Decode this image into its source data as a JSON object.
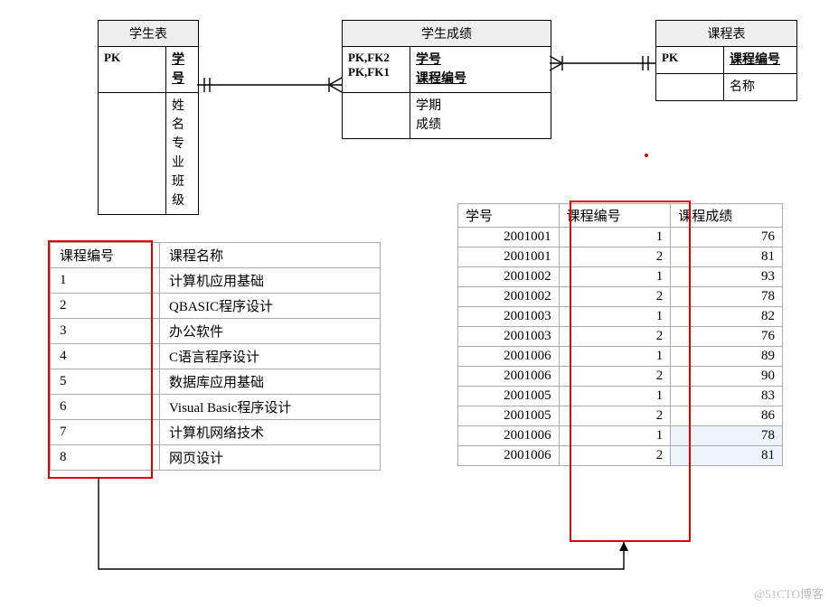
{
  "entities": {
    "student": {
      "title": "学生表",
      "pk_label": "PK",
      "pk_field": "学号",
      "body_fields": "姓名\n专业\n班级"
    },
    "score": {
      "title": "学生成绩",
      "pk_label": "PK,FK2\nPK,FK1",
      "pk_field": "学号\n课程编号",
      "body_fields": "学期\n成绩"
    },
    "course": {
      "title": "课程表",
      "pk_label": "PK",
      "pk_field": "课程编号",
      "body_fields": "名称"
    }
  },
  "course_table": {
    "headers": [
      "课程编号",
      "课程名称"
    ],
    "rows": [
      [
        "1",
        "计算机应用基础"
      ],
      [
        "2",
        "QBASIC程序设计"
      ],
      [
        "3",
        "办公软件"
      ],
      [
        "4",
        "C语言程序设计"
      ],
      [
        "5",
        "数据库应用基础"
      ],
      [
        "6",
        "Visual Basic程序设计"
      ],
      [
        "7",
        "计算机网络技术"
      ],
      [
        "8",
        "网页设计"
      ]
    ]
  },
  "score_table": {
    "headers": [
      "学号",
      "课程编号",
      "课程成绩"
    ],
    "rows": [
      [
        "2001001",
        "1",
        "76"
      ],
      [
        "2001001",
        "2",
        "81"
      ],
      [
        "2001002",
        "1",
        "93"
      ],
      [
        "2001002",
        "2",
        "78"
      ],
      [
        "2001003",
        "1",
        "82"
      ],
      [
        "2001003",
        "2",
        "76"
      ],
      [
        "2001006",
        "1",
        "89"
      ],
      [
        "2001006",
        "2",
        "90"
      ],
      [
        "2001005",
        "1",
        "83"
      ],
      [
        "2001005",
        "2",
        "86"
      ],
      [
        "2001006",
        "1",
        "78"
      ],
      [
        "2001006",
        "2",
        "81"
      ]
    ],
    "faded_rows": [
      10,
      11
    ]
  },
  "watermark": "@51CTO博客",
  "chart_data": {
    "type": "table",
    "description": "Entity-relationship diagram with three entities (学生表, 学生成绩, 课程表) connected by identifying relationships; below, two data tables illustrate foreign-key linkage between 课程编号 columns.",
    "entities": [
      {
        "name": "学生表",
        "pk": [
          "学号"
        ],
        "attrs": [
          "姓名",
          "专业",
          "班级"
        ]
      },
      {
        "name": "学生成绩",
        "pk": [
          "学号",
          "课程编号"
        ],
        "fk": [
          "学号",
          "课程编号"
        ],
        "attrs": [
          "学期",
          "成绩"
        ]
      },
      {
        "name": "课程表",
        "pk": [
          "课程编号"
        ],
        "attrs": [
          "名称"
        ]
      }
    ],
    "relationships": [
      {
        "from": "学生表",
        "to": "学生成绩",
        "cardinality": "1:N"
      },
      {
        "from": "课程表",
        "to": "学生成绩",
        "cardinality": "1:N"
      }
    ],
    "course_data": {
      "columns": [
        "课程编号",
        "课程名称"
      ],
      "rows": [
        [
          1,
          "计算机应用基础"
        ],
        [
          2,
          "QBASIC程序设计"
        ],
        [
          3,
          "办公软件"
        ],
        [
          4,
          "C语言程序设计"
        ],
        [
          5,
          "数据库应用基础"
        ],
        [
          6,
          "Visual Basic程序设计"
        ],
        [
          7,
          "计算机网络技术"
        ],
        [
          8,
          "网页设计"
        ]
      ]
    },
    "score_data": {
      "columns": [
        "学号",
        "课程编号",
        "课程成绩"
      ],
      "rows": [
        [
          2001001,
          1,
          76
        ],
        [
          2001001,
          2,
          81
        ],
        [
          2001002,
          1,
          93
        ],
        [
          2001002,
          2,
          78
        ],
        [
          2001003,
          1,
          82
        ],
        [
          2001003,
          2,
          76
        ],
        [
          2001006,
          1,
          89
        ],
        [
          2001006,
          2,
          90
        ],
        [
          2001005,
          1,
          83
        ],
        [
          2001005,
          2,
          86
        ],
        [
          2001006,
          1,
          78
        ],
        [
          2001006,
          2,
          81
        ]
      ]
    }
  }
}
